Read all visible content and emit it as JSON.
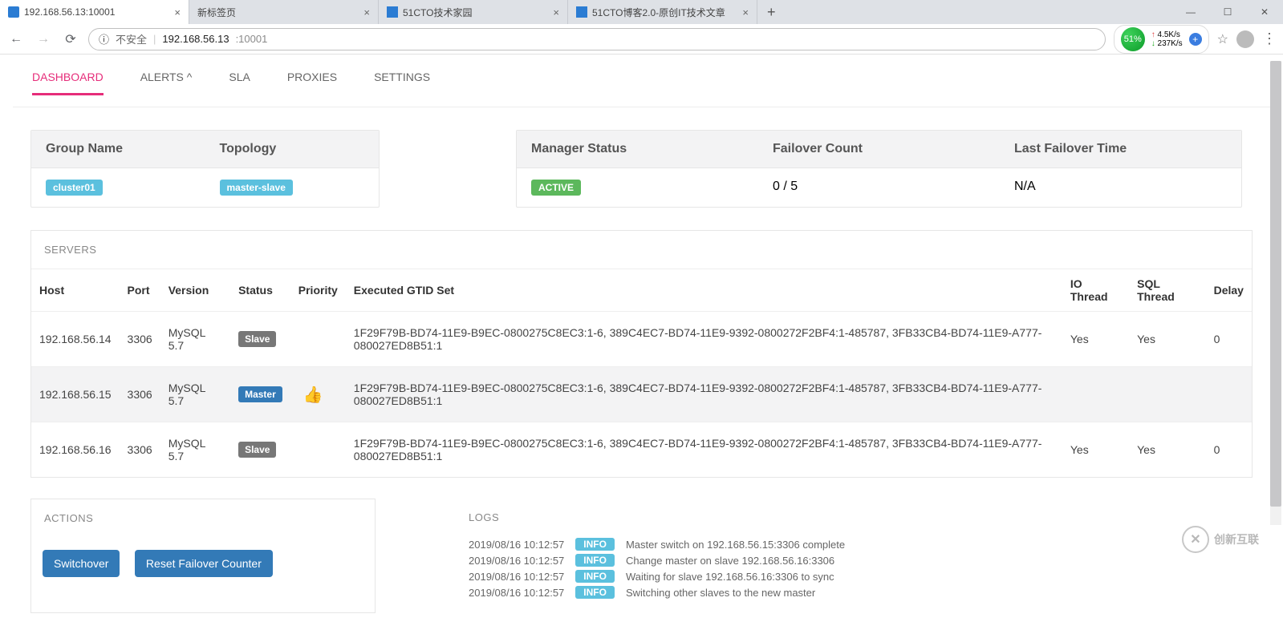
{
  "browser": {
    "tabs": [
      {
        "title": "192.168.56.13:10001",
        "icon_color": "#2b7cd3"
      },
      {
        "title": "新标签页",
        "icon_color": ""
      },
      {
        "title": "51CTO技术家园",
        "icon_color": "#2b7cd3"
      },
      {
        "title": "51CTO博客2.0-原创IT技术文章",
        "icon_color": "#2b7cd3"
      }
    ],
    "url_insecure": "不安全",
    "url_host": "192.168.56.13",
    "url_port": ":10001",
    "ext": {
      "percent": "51%",
      "up": "4.5K/s",
      "down": "237K/s"
    }
  },
  "nav": [
    "DASHBOARD",
    "ALERTS ^",
    "SLA",
    "PROXIES",
    "SETTINGS"
  ],
  "cluster_card": {
    "headers": [
      "Group Name",
      "Topology"
    ],
    "group": "cluster01",
    "topology": "master-slave"
  },
  "status_card": {
    "headers": [
      "Manager Status",
      "Failover Count",
      "Last Failover Time"
    ],
    "status": "ACTIVE",
    "count": "0 / 5",
    "last": "N/A"
  },
  "servers": {
    "title": "SERVERS",
    "cols": [
      "Host",
      "Port",
      "Version",
      "Status",
      "Priority",
      "Executed GTID Set",
      "IO Thread",
      "SQL Thread",
      "Delay"
    ],
    "rows": [
      {
        "host": "192.168.56.14",
        "port": "3306",
        "version": "MySQL 5.7",
        "role": "Slave",
        "master": false,
        "gtid": "1F29F79B-BD74-11E9-B9EC-0800275C8EC3:1-6, 389C4EC7-BD74-11E9-9392-0800272F2BF4:1-485787, 3FB33CB4-BD74-11E9-A777-080027ED8B51:1",
        "io": "Yes",
        "sql": "Yes",
        "delay": "0"
      },
      {
        "host": "192.168.56.15",
        "port": "3306",
        "version": "MySQL 5.7",
        "role": "Master",
        "master": true,
        "gtid": "1F29F79B-BD74-11E9-B9EC-0800275C8EC3:1-6, 389C4EC7-BD74-11E9-9392-0800272F2BF4:1-485787, 3FB33CB4-BD74-11E9-A777-080027ED8B51:1",
        "io": "",
        "sql": "",
        "delay": ""
      },
      {
        "host": "192.168.56.16",
        "port": "3306",
        "version": "MySQL 5.7",
        "role": "Slave",
        "master": false,
        "gtid": "1F29F79B-BD74-11E9-B9EC-0800275C8EC3:1-6, 389C4EC7-BD74-11E9-9392-0800272F2BF4:1-485787, 3FB33CB4-BD74-11E9-A777-080027ED8B51:1",
        "io": "Yes",
        "sql": "Yes",
        "delay": "0"
      }
    ]
  },
  "actions": {
    "title": "ACTIONS",
    "switchover": "Switchover",
    "reset": "Reset Failover Counter"
  },
  "logs": {
    "title": "LOGS",
    "level": "INFO",
    "lines": [
      {
        "ts": "2019/08/16 10:12:57",
        "msg": "Master switch on 192.168.56.15:3306 complete"
      },
      {
        "ts": "2019/08/16 10:12:57",
        "msg": "Change master on slave 192.168.56.16:3306"
      },
      {
        "ts": "2019/08/16 10:12:57",
        "msg": "Waiting for slave 192.168.56.16:3306 to sync"
      },
      {
        "ts": "2019/08/16 10:12:57",
        "msg": "Switching other slaves to the new master"
      }
    ]
  },
  "watermark": "创新互联"
}
